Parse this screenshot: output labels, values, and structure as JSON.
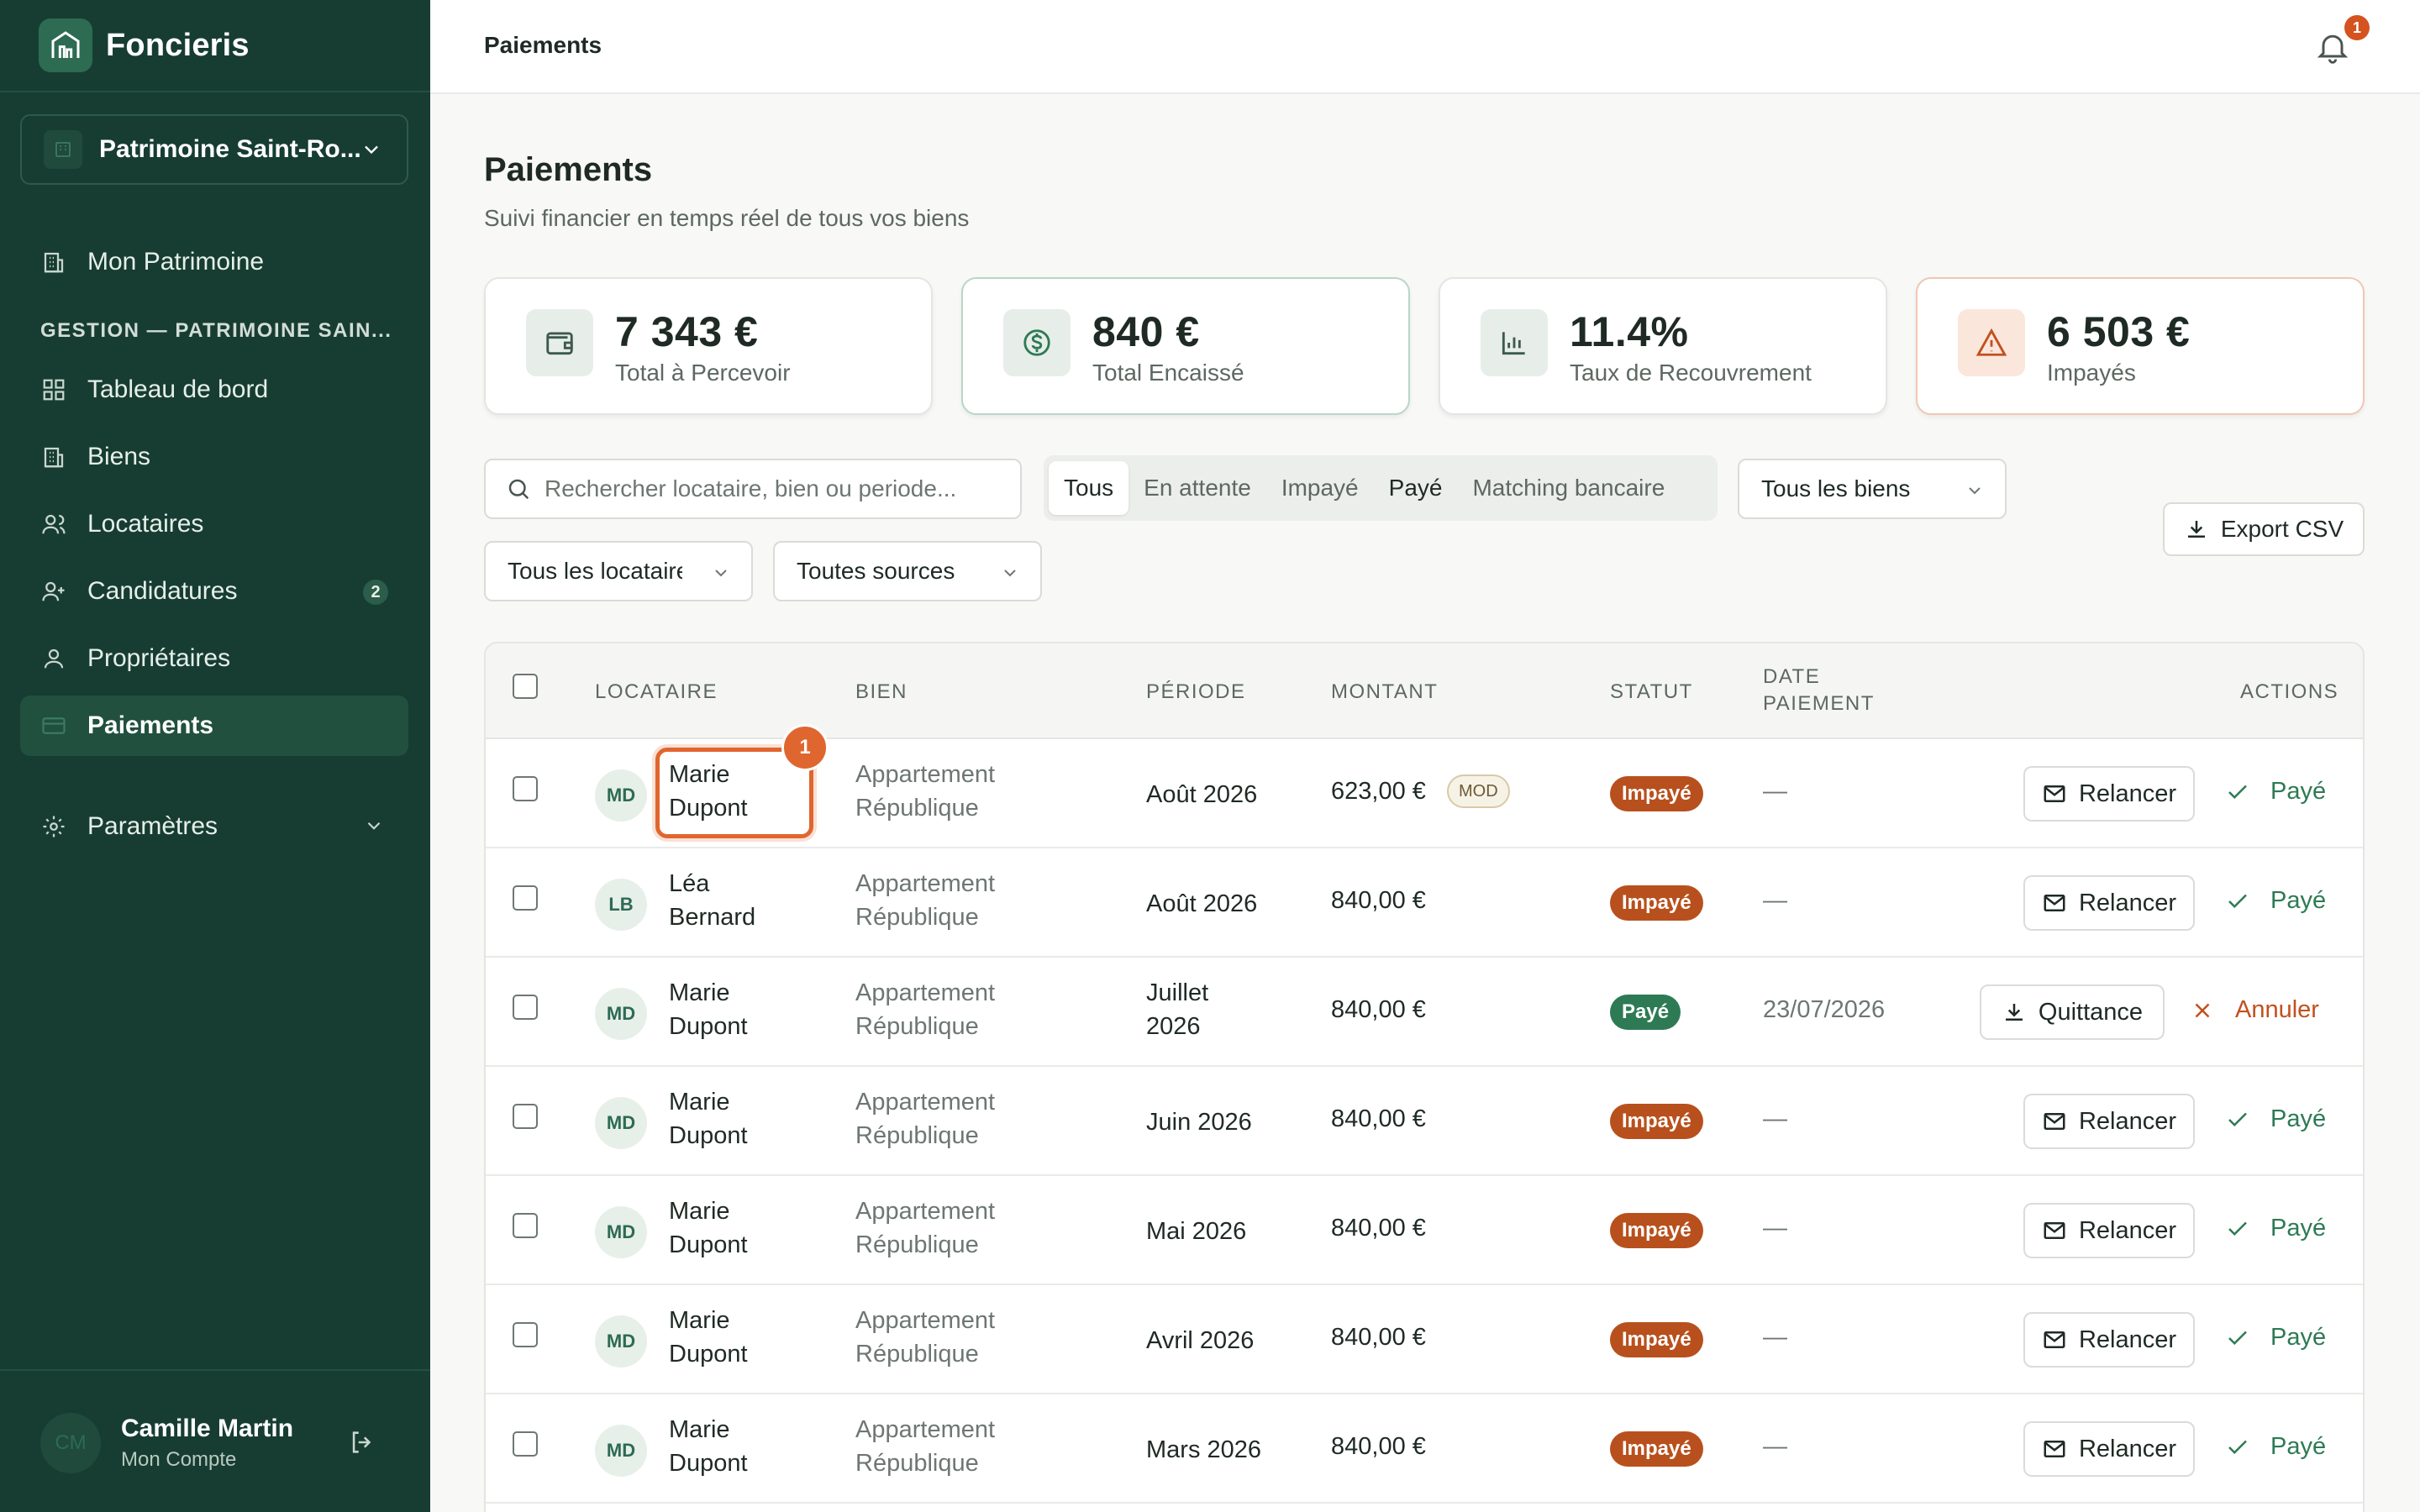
{
  "app": {
    "name": "Foncieris"
  },
  "org": {
    "name": "Patrimoine Saint-Ro..."
  },
  "nav": {
    "top": {
      "label": "Mon Patrimoine"
    },
    "section": "GESTION — PATRIMOINE SAIN...",
    "items": [
      {
        "label": "Tableau de bord"
      },
      {
        "label": "Biens"
      },
      {
        "label": "Locataires"
      },
      {
        "label": "Candidatures",
        "badge": "2"
      },
      {
        "label": "Propriétaires"
      },
      {
        "label": "Paiements",
        "active": true
      }
    ],
    "settings": {
      "label": "Paramètres"
    }
  },
  "user": {
    "initials": "CM",
    "name": "Camille Martin",
    "subtitle": "Mon Compte"
  },
  "topbar": {
    "title": "Paiements",
    "notifications": "1"
  },
  "page": {
    "title": "Paiements",
    "subtitle": "Suivi financier en temps réel de tous vos biens"
  },
  "stats": [
    {
      "value": "7 343 €",
      "label": "Total à Percevoir",
      "icon": "wallet-icon"
    },
    {
      "value": "840 €",
      "label": "Total Encaissé",
      "icon": "dollar-circle-icon"
    },
    {
      "value": "11.4%",
      "label": "Taux de Recouvrement",
      "icon": "bar-chart-icon"
    },
    {
      "value": "6 503 €",
      "label": "Impayés",
      "icon": "warning-icon"
    }
  ],
  "filters": {
    "search_placeholder": "Rechercher locataire, bien ou periode...",
    "tabs": [
      "Tous",
      "En attente",
      "Impayé",
      "Payé",
      "Matching bancaire"
    ],
    "active_tab": "Tous",
    "biens": "Tous les biens",
    "locataires": "Tous les locataires",
    "sources": "Toutes sources",
    "export": "Export CSV"
  },
  "table": {
    "headers": {
      "locataire": "LOCATAIRE",
      "bien": "BIEN",
      "periode": "PÉRIODE",
      "montant": "MONTANT",
      "statut": "STATUT",
      "date1": "DATE",
      "date2": "PAIEMENT",
      "actions": "ACTIONS"
    },
    "rows": [
      {
        "initials": "MD",
        "first": "Marie",
        "last": "Dupont",
        "bien1": "Appartement",
        "bien2": "République",
        "periode": "Août 2026",
        "montant": "623,00 €",
        "mod": "MOD",
        "statut": "Impayé",
        "date": "—",
        "action": "Relancer",
        "secondary": "Payé"
      },
      {
        "initials": "LB",
        "first": "Léa",
        "last": "Bernard",
        "bien1": "Appartement",
        "bien2": "République",
        "periode": "Août 2026",
        "montant": "840,00 €",
        "statut": "Impayé",
        "date": "—",
        "action": "Relancer",
        "secondary": "Payé"
      },
      {
        "initials": "MD",
        "first": "Marie",
        "last": "Dupont",
        "bien1": "Appartement",
        "bien2": "République",
        "periode": "Juillet 2026",
        "montant": "840,00 €",
        "statut": "Payé",
        "date": "23/07/2026",
        "action": "Quittance",
        "secondary": "Annuler"
      },
      {
        "initials": "MD",
        "first": "Marie",
        "last": "Dupont",
        "bien1": "Appartement",
        "bien2": "République",
        "periode": "Juin 2026",
        "montant": "840,00 €",
        "statut": "Impayé",
        "date": "—",
        "action": "Relancer",
        "secondary": "Payé"
      },
      {
        "initials": "MD",
        "first": "Marie",
        "last": "Dupont",
        "bien1": "Appartement",
        "bien2": "République",
        "periode": "Mai 2026",
        "montant": "840,00 €",
        "statut": "Impayé",
        "date": "—",
        "action": "Relancer",
        "secondary": "Payé"
      },
      {
        "initials": "MD",
        "first": "Marie",
        "last": "Dupont",
        "bien1": "Appartement",
        "bien2": "République",
        "periode": "Avril 2026",
        "montant": "840,00 €",
        "statut": "Impayé",
        "date": "—",
        "action": "Relancer",
        "secondary": "Payé"
      },
      {
        "initials": "MD",
        "first": "Marie",
        "last": "Dupont",
        "bien1": "Appartement",
        "bien2": "République",
        "periode": "Mars 2026",
        "montant": "840,00 €",
        "statut": "Impayé",
        "date": "—",
        "action": "Relancer",
        "secondary": "Payé"
      }
    ]
  },
  "annotation": {
    "marker": "1"
  },
  "colors": {
    "sidebar": "#173d32",
    "accent": "#2d7a54",
    "danger": "#b8501d",
    "highlight": "#e0662f"
  }
}
